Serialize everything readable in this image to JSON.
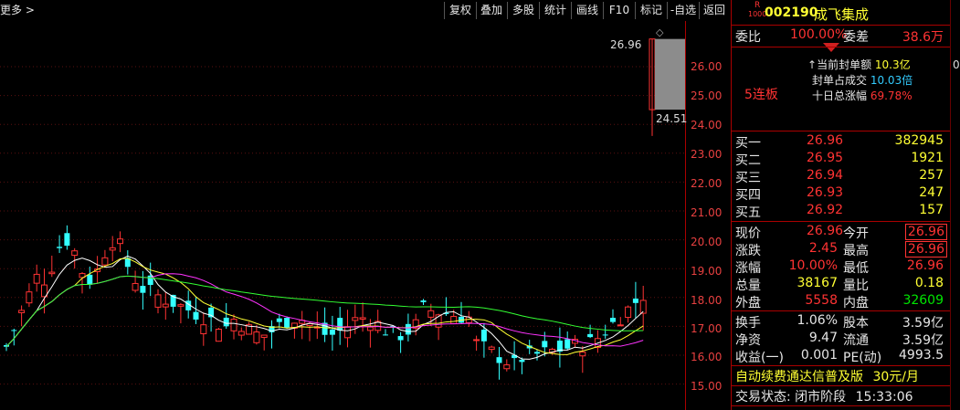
{
  "toolbar": {
    "more": "更多 >",
    "buttons": [
      "复权",
      "叠加",
      "多股",
      "统计",
      "画线",
      "F10",
      "标记",
      "-自选",
      "返回"
    ]
  },
  "chart": {
    "price_ticks": [
      "26.00",
      "25.00",
      "24.00",
      "23.00",
      "22.00",
      "21.00",
      "20.00",
      "19.00",
      "18.00",
      "17.00",
      "16.00",
      "15.00"
    ],
    "high_label": "26.96",
    "last_label": "24.51",
    "lianban": "5连板"
  },
  "chart_data": {
    "type": "candlestick",
    "ylim": [
      14.5,
      27.0
    ],
    "latest": {
      "open": 24.51,
      "close": 26.96,
      "high": 26.96,
      "low": 23.6
    },
    "markers": [
      "26.96",
      "24.51"
    ]
  },
  "stock": {
    "code": "002190",
    "name": "成飞集成",
    "rz": "R",
    "rz_sub": "1000",
    "weibi_label": "委比",
    "weibi_value": "100.00%",
    "weicha_label": "委差",
    "weicha_value": "38.6万",
    "feng_dan_label": "当前封单额",
    "feng_dan_value": "10.3亿",
    "feng_cheng_label": "封单占成交",
    "feng_cheng_value": "10.03倍",
    "shiri_label": "十日总涨幅",
    "shiri_value": "69.78%",
    "lianban": "5连板"
  },
  "bids": [
    {
      "label": "买一",
      "price": "26.96",
      "vol": "382945"
    },
    {
      "label": "买二",
      "price": "26.95",
      "vol": "1921"
    },
    {
      "label": "买三",
      "price": "26.94",
      "vol": "257"
    },
    {
      "label": "买四",
      "price": "26.93",
      "vol": "247"
    },
    {
      "label": "买五",
      "price": "26.92",
      "vol": "157"
    }
  ],
  "quote": {
    "xianjia_l": "现价",
    "xianjia": "26.96",
    "jinkai_l": "今开",
    "jinkai": "26.96",
    "zhangdie_l": "涨跌",
    "zhangdie": "2.45",
    "zuigao_l": "最高",
    "zuigao": "26.96",
    "zhangfu_l": "涨幅",
    "zhangfu": "10.00%",
    "zuidi_l": "最低",
    "zuidi": "26.96",
    "zongliang_l": "总量",
    "zongliang": "38167",
    "liangbi_l": "量比",
    "liangbi": "0.18",
    "waipan_l": "外盘",
    "waipan": "5558",
    "neipan_l": "内盘",
    "neipan": "32609",
    "huanshou_l": "换手",
    "huanshou": "1.06%",
    "guben_l": "股本",
    "guben": "3.59亿",
    "jingzi_l": "净资",
    "jingzi": "9.47",
    "liutong_l": "流通",
    "liutong": "3.59亿",
    "shouyi_l": "收益(一)",
    "shouyi": "0.001",
    "pe_l": "PE(动)",
    "pe": "4993.5"
  },
  "footer": {
    "promo": "自动续费通达信普及版",
    "price": "30元/月",
    "status_label": "交易状态:",
    "status": "闭市阶段",
    "time": "15:33:06"
  },
  "right_strip": {
    "label": "0"
  }
}
